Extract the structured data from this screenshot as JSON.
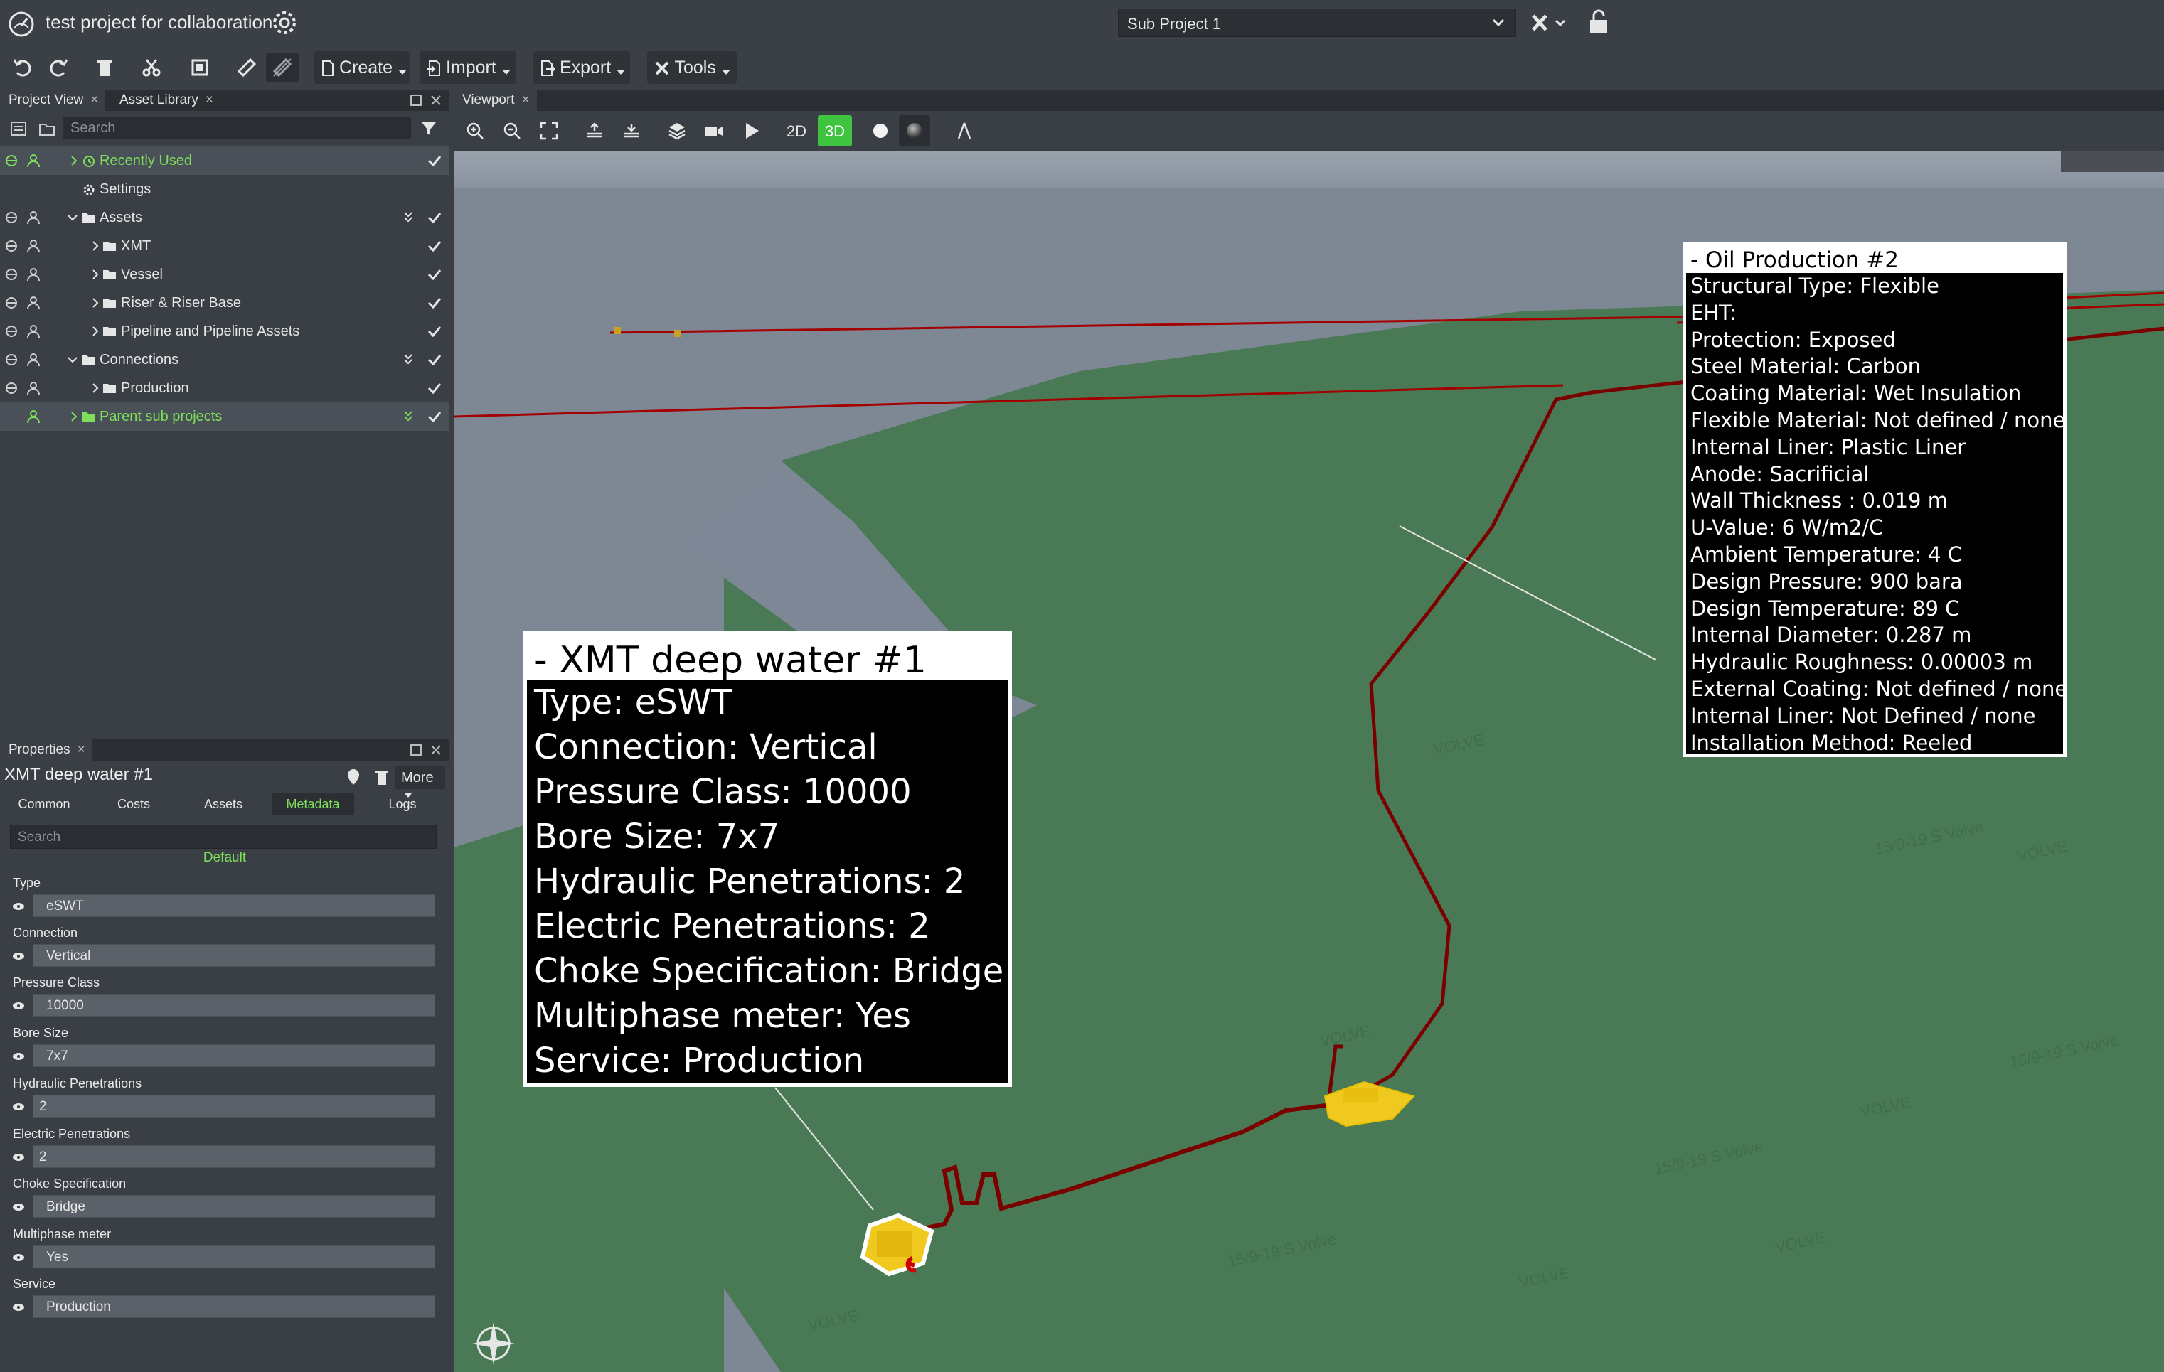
{
  "window": {
    "title": "test project for collaboration",
    "sub_project": "Sub Project 1"
  },
  "toolbar": {
    "create": "Create",
    "import": "Import",
    "export": "Export",
    "tools": "Tools"
  },
  "left_tabs": {
    "project_view": "Project View",
    "asset_library": "Asset Library",
    "close": "×"
  },
  "tree": {
    "search_placeholder": "Search",
    "items": [
      {
        "label": "Recently Used"
      },
      {
        "label": "Settings"
      },
      {
        "label": "Assets"
      },
      {
        "label": "XMT"
      },
      {
        "label": "Vessel"
      },
      {
        "label": "Riser & Riser Base"
      },
      {
        "label": "Pipeline and Pipeline Assets"
      },
      {
        "label": "Connections"
      },
      {
        "label": "Production"
      },
      {
        "label": "Parent sub projects"
      }
    ]
  },
  "properties": {
    "tab": "Properties",
    "title": "XMT deep water #1",
    "more": "More",
    "tabs": [
      "Common",
      "Costs",
      "Assets",
      "Metadata",
      "Logs"
    ],
    "active_tab": "Metadata",
    "search_placeholder": "Search",
    "group": "Default",
    "fields": [
      {
        "label": "Type",
        "value": "eSWT"
      },
      {
        "label": "Connection",
        "value": "Vertical"
      },
      {
        "label": "Pressure Class",
        "value": "10000"
      },
      {
        "label": "Bore Size",
        "value": "7x7"
      },
      {
        "label": "Hydraulic Penetrations",
        "value": "2"
      },
      {
        "label": "Electric Penetrations",
        "value": "2"
      },
      {
        "label": "Choke Specification",
        "value": "Bridge"
      },
      {
        "label": "Multiphase meter",
        "value": "Yes"
      },
      {
        "label": "Service",
        "value": "Production"
      }
    ]
  },
  "viewport": {
    "tab": "Viewport",
    "mode_2d": "2D",
    "mode_3d": "3D",
    "active_mode": "3D",
    "seabed_label": "VOLVE",
    "seabed_sublabel": "15/9-19 S Volve"
  },
  "callout_xmt": {
    "title": "- XMT deep water #1",
    "lines": [
      "Type: eSWT",
      "Connection: Vertical",
      "Pressure Class: 10000",
      "Bore Size: 7x7",
      "Hydraulic Penetrations: 2",
      "Electric Penetrations: 2",
      "Choke Specification: Bridge",
      "Multiphase meter: Yes",
      "Service: Production"
    ]
  },
  "callout_pipe": {
    "title": "- Oil Production #2",
    "lines": [
      "Structural Type: Flexible",
      "EHT:",
      "Protection: Exposed",
      "Steel Material: Carbon",
      "Coating Material: Wet Insulation",
      "Flexible Material: Not defined / none",
      "Internal Liner: Plastic Liner",
      "Anode: Sacrificial",
      "Wall Thickness : 0.019 m",
      "U-Value: 6 W/m2/C",
      "Ambient Temperature: 4 C",
      "Design Pressure: 900 bara",
      "Design Temperature: 89 C",
      "Internal Diameter: 0.287 m",
      "Hydraulic Roughness: 0.00003 m",
      "External Coating: Not defined / none",
      "Internal Liner: Not Defined / none",
      "Installation Method: Reeled"
    ]
  },
  "colors": {
    "accent_green": "#3ec43e",
    "tree_green": "#7ee05a",
    "pipeline_red": "#a40000",
    "seabed": "#4a7a55"
  }
}
